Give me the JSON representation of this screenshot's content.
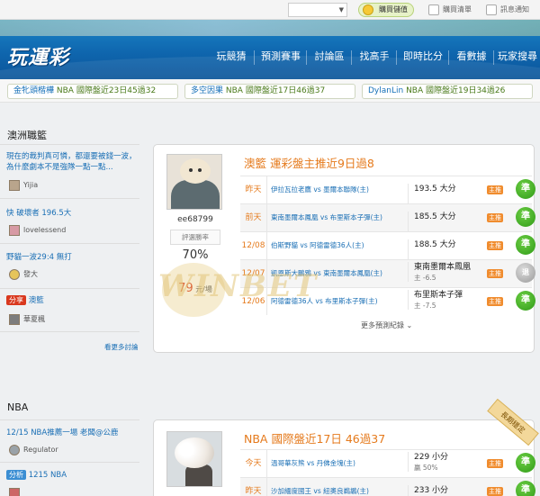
{
  "topbar": {
    "select_value": "",
    "items": [
      {
        "label": "購買儲值",
        "icon": "coin-icon"
      },
      {
        "label": "購買清單",
        "icon": "list-icon"
      },
      {
        "label": "訊息通知",
        "icon": "mail-icon"
      }
    ]
  },
  "header": {
    "logo": "玩運彩",
    "nav": [
      "玩競猜",
      "預測賽事",
      "討論區",
      "找高手",
      "即時比分",
      "看數據",
      "玩家搜尋"
    ]
  },
  "ticker": [
    {
      "user": "金牝頭楷樺",
      "text": "NBA 國際盤近23日45過32"
    },
    {
      "user": "多空因果",
      "text": "NBA 國際盤近17日46過37"
    },
    {
      "user": "DylanLin",
      "text": "NBA 國際盤近19日34過26"
    }
  ],
  "sidebar": {
    "section1_title": "澳洲職籃",
    "posts": [
      {
        "text": "現在的裁判真可憐，都還要被錢一波，為什麼劇本不是強隊一點一點...",
        "user": "Yijia"
      },
      {
        "text": "快 破壞者 196.5大",
        "user": "lovelessend"
      },
      {
        "text": "野貓一波29:4 無打",
        "user": "發大"
      },
      {
        "tag": "分享",
        "text": "澳籃",
        "user": "華夏楓"
      }
    ],
    "more_link": "看更多討論",
    "section2_title": "NBA",
    "posts2": [
      {
        "text": "12/15 NBA推薦一場 老闆@公鹿",
        "user": "Regulator"
      },
      {
        "tag": "分析",
        "text": "1215 NBA",
        "user": ""
      }
    ]
  },
  "card1": {
    "username": "ee68799",
    "rate_label": "評選勝率",
    "rate": "70%",
    "price_value": "79",
    "price_unit": "元/場",
    "title": "澳籃  運彩盤主推近9日過8",
    "rows": [
      {
        "date": "昨天",
        "match": "伊拉瓦拉老鷹 vs 墨爾本聯隊(主)",
        "pick": "193.5 大分",
        "sub": "",
        "badge": "主推",
        "result": "準"
      },
      {
        "date": "前天",
        "match": "東南墨爾本鳳凰 vs 布里斯本子彈(主)",
        "pick": "185.5 大分",
        "sub": "",
        "badge": "主推",
        "result": "準"
      },
      {
        "date": "12/08",
        "match": "伯斯野貓 vs 阿德雷德36人(主)",
        "pick": "188.5 大分",
        "sub": "",
        "badge": "主推",
        "result": "準"
      },
      {
        "date": "12/07",
        "match": "凱恩斯大鵬鴉 vs 東南墨爾本鳳凰(主)",
        "pick": "東南墨爾本鳳凰",
        "sub": "主 -6.5",
        "badge": "主推",
        "result": "退"
      },
      {
        "date": "12/06",
        "match": "阿德雷德36人 vs 布里斯本子彈(主)",
        "pick": "布里斯本子彈",
        "sub": "主 -7.5",
        "badge": "主推",
        "result": "準"
      }
    ],
    "more": "更多預測紀錄"
  },
  "card2": {
    "title": "NBA  國際盤近17日  46過37",
    "ribbon": "長期穩定",
    "rows": [
      {
        "date": "今天",
        "match": "溫哥華灰熊 vs 丹佛金塊(主)",
        "pick": "229 小分",
        "sub": "贏 50%",
        "badge": "主推",
        "result": "準"
      },
      {
        "date": "昨天",
        "match": "沙加緬度國王 vs 紐奧良鵜鶘(主)",
        "pick": "233 小分",
        "sub": "",
        "badge": "主推",
        "result": "準"
      }
    ]
  },
  "watermark": "WINBET"
}
